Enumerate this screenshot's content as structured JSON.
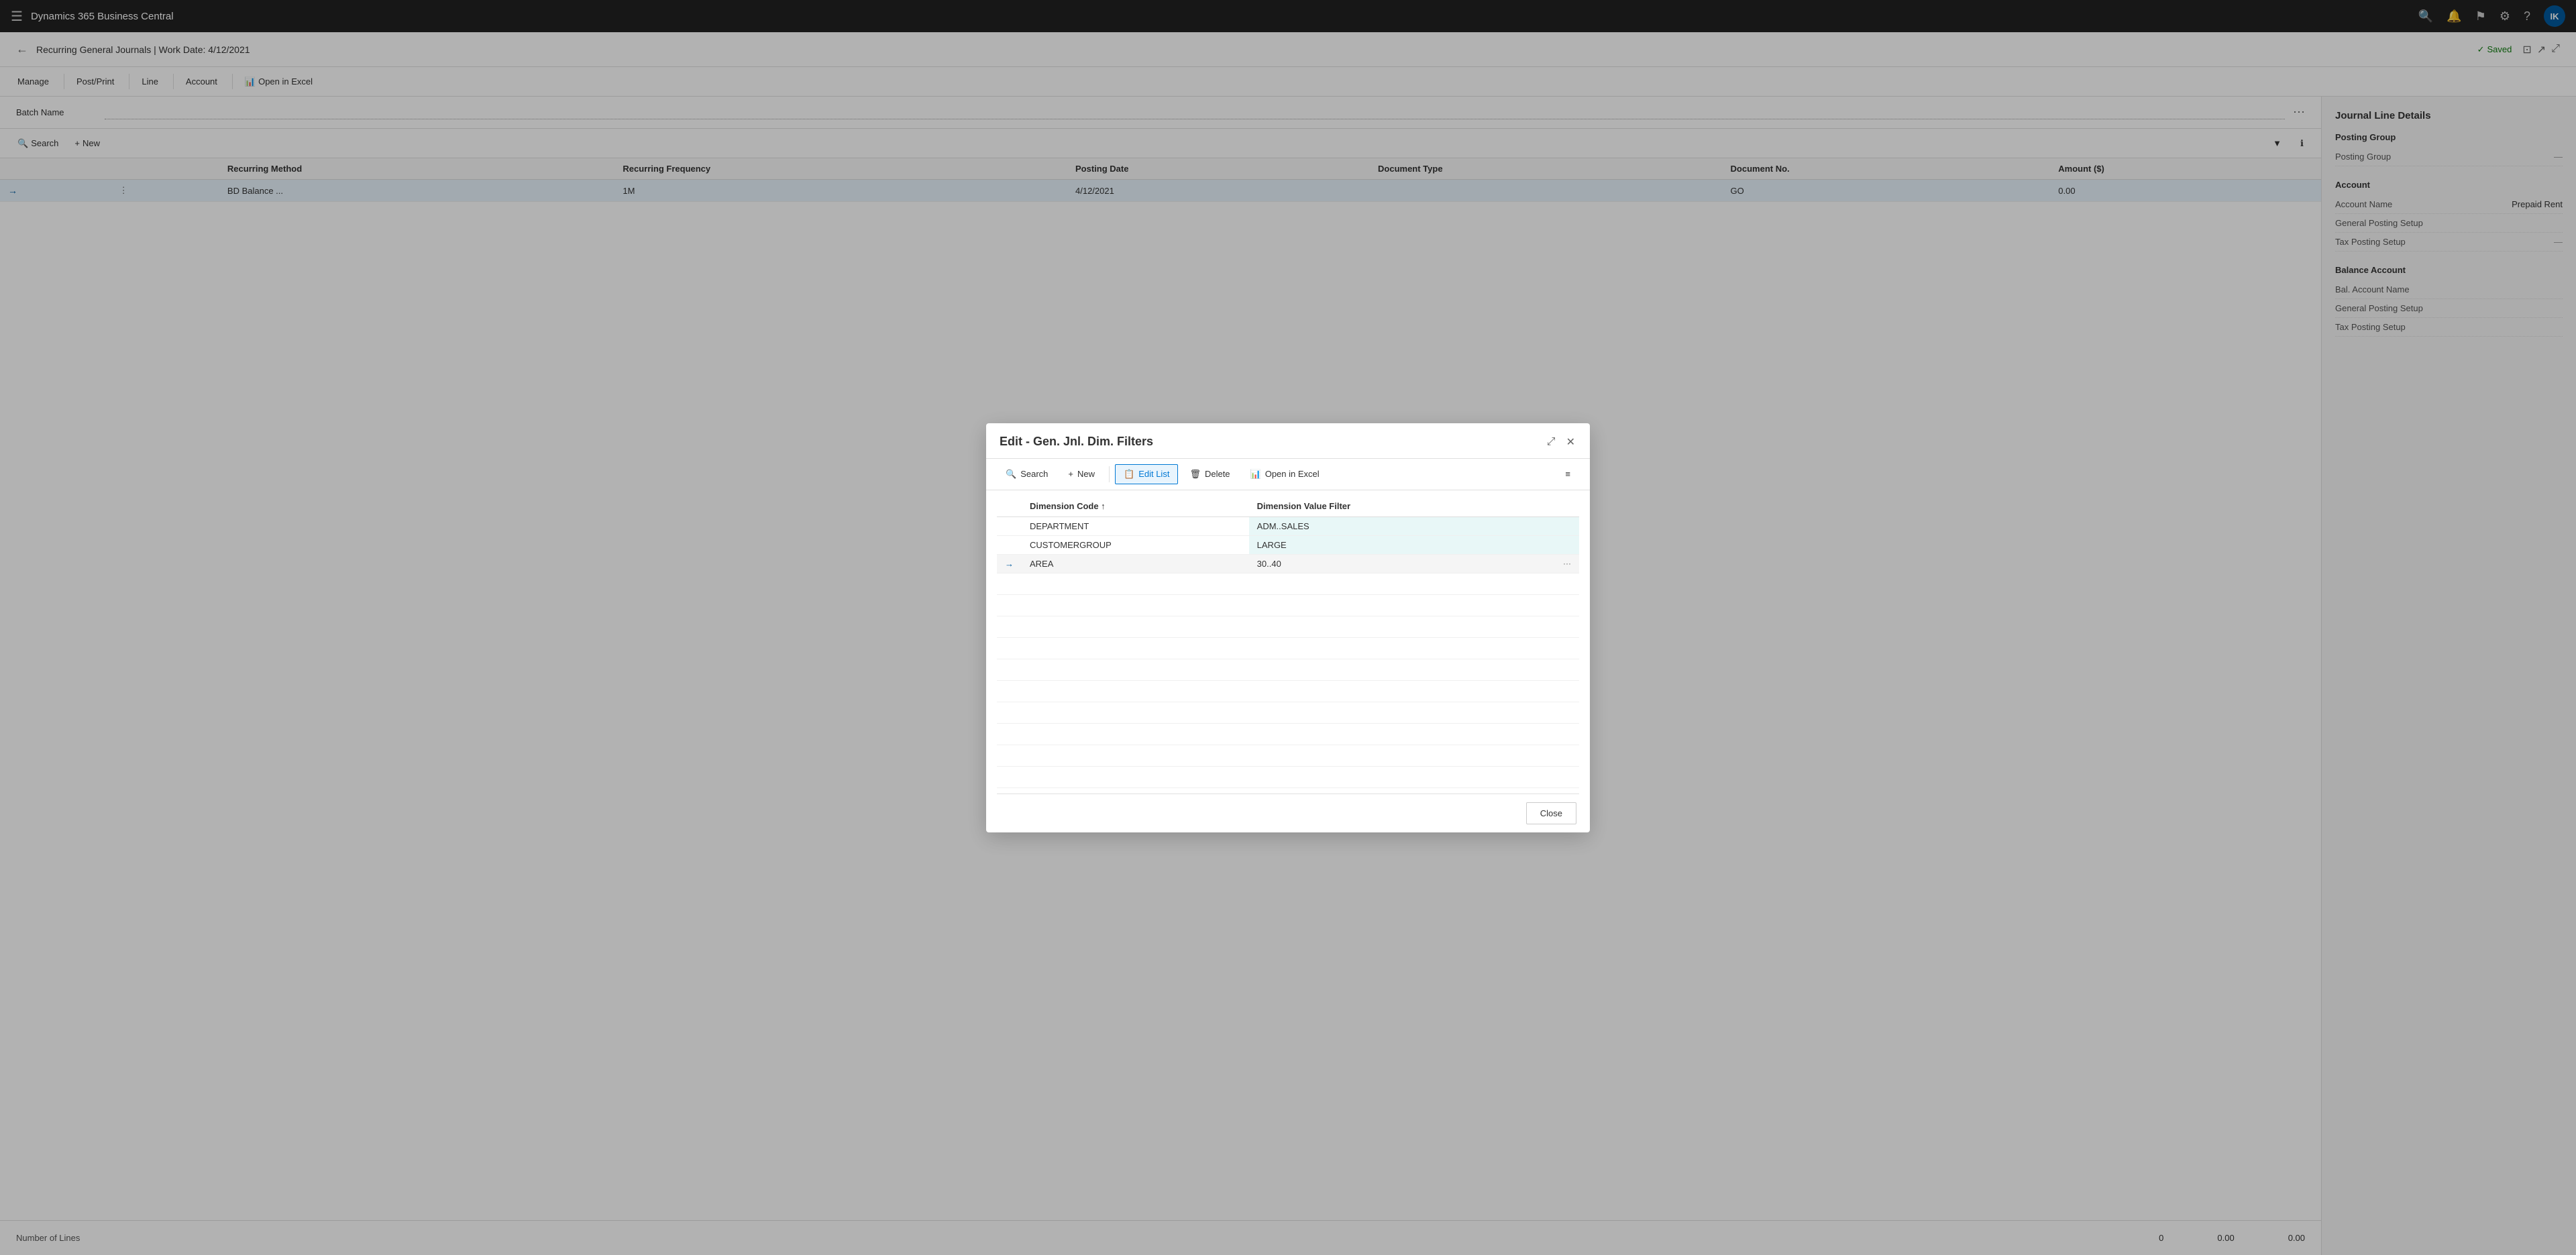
{
  "topBar": {
    "appTitle": "Dynamics 365 Business Central",
    "icons": {
      "search": "🔍",
      "notifications": "🔔",
      "bookmark": "⚑",
      "settings": "⚙",
      "help": "?"
    },
    "avatar": "IK"
  },
  "pageHeader": {
    "title": "Recurring General Journals | Work Date: 4/12/2021",
    "saved": "Saved",
    "icons": {
      "back": "←",
      "restore": "⊡",
      "popout": "↗",
      "expand": "⤢"
    }
  },
  "toolbar": {
    "groups": [
      {
        "name": "manage",
        "label": "Manage"
      },
      {
        "name": "postprint",
        "label": "Post/Print"
      },
      {
        "name": "line",
        "label": "Line"
      },
      {
        "name": "account",
        "label": "Account"
      },
      {
        "name": "openinexcel",
        "label": "Open in Excel",
        "icon": "📊"
      }
    ]
  },
  "batchRow": {
    "label": "Batch Name"
  },
  "tableToolbar": {
    "searchLabel": "Search",
    "newLabel": "New",
    "filterIcon": "▼",
    "infoIcon": "ℹ"
  },
  "journalTable": {
    "headers": [
      "",
      "",
      "Recurring Method",
      "Recurring Frequency",
      "Posting Date",
      "Document Type",
      "Document No.",
      "Amount ($)"
    ],
    "rows": [
      {
        "arrow": "→",
        "menu": "⋮",
        "recurringMethod": "BD Balance ...",
        "recurringFrequency": "1M",
        "postingDate": "4/12/2021",
        "documentType": "",
        "documentNo": "GO",
        "amount": "0.00"
      }
    ]
  },
  "sidePanel": {
    "title": "Journal Line Details",
    "sections": [
      {
        "name": "posting",
        "title": "Posting Group",
        "fields": [
          {
            "label": "Posting Group",
            "value": "—"
          }
        ]
      },
      {
        "name": "account",
        "title": "Account",
        "fields": [
          {
            "label": "Account Name",
            "value": "Prepaid Rent"
          },
          {
            "label": "General Posting Setup",
            "value": ""
          },
          {
            "label": "Tax Posting Setup",
            "value": "—"
          }
        ]
      },
      {
        "name": "balanceAccount",
        "title": "Balance Account",
        "fields": [
          {
            "label": "Bal. Account Name",
            "value": ""
          },
          {
            "label": "General Posting Setup",
            "value": ""
          },
          {
            "label": "Tax Posting Setup",
            "value": ""
          }
        ]
      }
    ]
  },
  "footer": {
    "label": "Number of Lines",
    "debitAmount": "0",
    "creditAmount": "0.00",
    "balanceAmount": "0.00"
  },
  "modal": {
    "title": "Edit - Gen. Jnl. Dim. Filters",
    "toolbar": {
      "searchLabel": "Search",
      "searchIcon": "🔍",
      "newLabel": "New",
      "newIcon": "+",
      "editListLabel": "Edit List",
      "editListIcon": "📋",
      "deleteLabel": "Delete",
      "deleteIcon": "🗑",
      "openExcelLabel": "Open in Excel",
      "openExcelIcon": "📊",
      "settingsIcon": "≡"
    },
    "table": {
      "headers": [
        "",
        "Dimension Code ↑",
        "Dimension Value Filter"
      ],
      "rows": [
        {
          "arrow": "",
          "dimensionCode": "DEPARTMENT",
          "dimensionValueFilter": "ADM..SALES",
          "selected": false,
          "active": false
        },
        {
          "arrow": "",
          "dimensionCode": "CUSTOMERGROUP",
          "dimensionValueFilter": "LARGE",
          "selected": false,
          "active": false
        },
        {
          "arrow": "→",
          "dimensionCode": "AREA",
          "dimensionValueFilter": "30..40",
          "selected": true,
          "active": true
        }
      ]
    },
    "closeButton": "Close",
    "icons": {
      "expand": "⤢",
      "close": "✕"
    }
  }
}
